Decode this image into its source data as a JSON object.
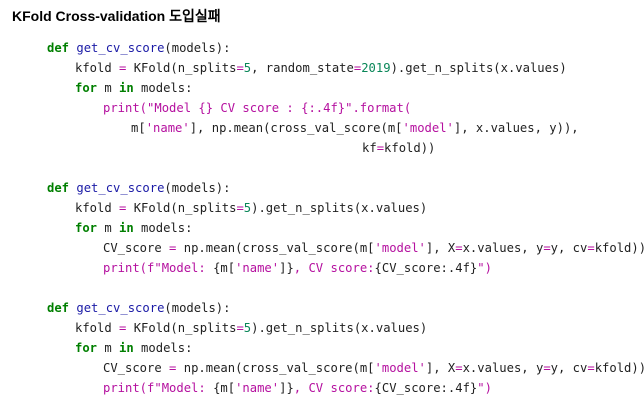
{
  "heading": "KFold Cross-validation 도입실패",
  "colors": {
    "keyword": "#007f00",
    "function_name": "#1a1aa6",
    "string": "#b5109f",
    "number": "#098658",
    "operator": "#b5109f",
    "plain": "#1f1f1f",
    "background": "#ffffff"
  },
  "code_blocks": [
    {
      "lines": [
        {
          "indent": 0,
          "tokens": [
            {
              "t": "kw",
              "v": "def"
            },
            {
              "t": "plain",
              "v": " "
            },
            {
              "t": "fn",
              "v": "get_cv_score"
            },
            {
              "t": "plain",
              "v": "(models):"
            }
          ]
        },
        {
          "indent": 1,
          "tokens": [
            {
              "t": "plain",
              "v": "kfold "
            },
            {
              "t": "op",
              "v": "="
            },
            {
              "t": "plain",
              "v": " KFold(n_splits"
            },
            {
              "t": "op",
              "v": "="
            },
            {
              "t": "num",
              "v": "5"
            },
            {
              "t": "plain",
              "v": ", random_state"
            },
            {
              "t": "op",
              "v": "="
            },
            {
              "t": "num",
              "v": "2019"
            },
            {
              "t": "plain",
              "v": ").get_n_splits(x.values)"
            }
          ]
        },
        {
          "indent": 1,
          "tokens": [
            {
              "t": "kw",
              "v": "for"
            },
            {
              "t": "plain",
              "v": " m "
            },
            {
              "t": "kw",
              "v": "in"
            },
            {
              "t": "plain",
              "v": " models:"
            }
          ]
        },
        {
          "indent": 2,
          "tokens": [
            {
              "t": "str",
              "v": "print(\"Model {} CV score : {:.4f}\".format("
            }
          ]
        },
        {
          "indent": 3,
          "tokens": [
            {
              "t": "plain",
              "v": "m["
            },
            {
              "t": "str",
              "v": "'name'"
            },
            {
              "t": "plain",
              "v": "], np.mean(cross_val_score(m["
            },
            {
              "t": "str",
              "v": "'model'"
            },
            {
              "t": "plain",
              "v": "], x.values, y)),"
            }
          ]
        },
        {
          "indent": 4,
          "tokens": [
            {
              "t": "plain",
              "v": "kf"
            },
            {
              "t": "op",
              "v": "="
            },
            {
              "t": "plain",
              "v": "kfold))"
            }
          ]
        }
      ]
    },
    {
      "lines": [
        {
          "indent": 0,
          "tokens": [
            {
              "t": "kw",
              "v": "def"
            },
            {
              "t": "plain",
              "v": " "
            },
            {
              "t": "fn",
              "v": "get_cv_score"
            },
            {
              "t": "plain",
              "v": "(models):"
            }
          ]
        },
        {
          "indent": 1,
          "tokens": [
            {
              "t": "plain",
              "v": "kfold "
            },
            {
              "t": "op",
              "v": "="
            },
            {
              "t": "plain",
              "v": " KFold(n_splits"
            },
            {
              "t": "op",
              "v": "="
            },
            {
              "t": "num",
              "v": "5"
            },
            {
              "t": "plain",
              "v": ").get_n_splits(x.values)"
            }
          ]
        },
        {
          "indent": 1,
          "tokens": [
            {
              "t": "kw",
              "v": "for"
            },
            {
              "t": "plain",
              "v": " m "
            },
            {
              "t": "kw",
              "v": "in"
            },
            {
              "t": "plain",
              "v": " models:"
            }
          ]
        },
        {
          "indent": 2,
          "tokens": [
            {
              "t": "plain",
              "v": "CV_score "
            },
            {
              "t": "op",
              "v": "="
            },
            {
              "t": "plain",
              "v": " np.mean(cross_val_score(m["
            },
            {
              "t": "str",
              "v": "'model'"
            },
            {
              "t": "plain",
              "v": "], X"
            },
            {
              "t": "op",
              "v": "="
            },
            {
              "t": "plain",
              "v": "x.values, y"
            },
            {
              "t": "op",
              "v": "="
            },
            {
              "t": "plain",
              "v": "y, cv"
            },
            {
              "t": "op",
              "v": "="
            },
            {
              "t": "plain",
              "v": "kfold))"
            }
          ]
        },
        {
          "indent": 2,
          "tokens": [
            {
              "t": "str",
              "v": "print(f\"Model: "
            },
            {
              "t": "plain",
              "v": "{m["
            },
            {
              "t": "str",
              "v": "'name'"
            },
            {
              "t": "plain",
              "v": "]}"
            },
            {
              "t": "str",
              "v": ", CV score:"
            },
            {
              "t": "plain",
              "v": "{CV_score:.4f}"
            },
            {
              "t": "str",
              "v": "\")"
            }
          ]
        }
      ]
    },
    {
      "lines": [
        {
          "indent": 0,
          "tokens": [
            {
              "t": "kw",
              "v": "def"
            },
            {
              "t": "plain",
              "v": " "
            },
            {
              "t": "fn",
              "v": "get_cv_score"
            },
            {
              "t": "plain",
              "v": "(models):"
            }
          ]
        },
        {
          "indent": 1,
          "tokens": [
            {
              "t": "plain",
              "v": "kfold "
            },
            {
              "t": "op",
              "v": "="
            },
            {
              "t": "plain",
              "v": " KFold(n_splits"
            },
            {
              "t": "op",
              "v": "="
            },
            {
              "t": "num",
              "v": "5"
            },
            {
              "t": "plain",
              "v": ").get_n_splits(x.values)"
            }
          ]
        },
        {
          "indent": 1,
          "tokens": [
            {
              "t": "kw",
              "v": "for"
            },
            {
              "t": "plain",
              "v": " m "
            },
            {
              "t": "kw",
              "v": "in"
            },
            {
              "t": "plain",
              "v": " models:"
            }
          ]
        },
        {
          "indent": 2,
          "tokens": [
            {
              "t": "plain",
              "v": "CV_score "
            },
            {
              "t": "op",
              "v": "="
            },
            {
              "t": "plain",
              "v": " np.mean(cross_val_score(m["
            },
            {
              "t": "str",
              "v": "'model'"
            },
            {
              "t": "plain",
              "v": "], X"
            },
            {
              "t": "op",
              "v": "="
            },
            {
              "t": "plain",
              "v": "x.values, y"
            },
            {
              "t": "op",
              "v": "="
            },
            {
              "t": "plain",
              "v": "y, cv"
            },
            {
              "t": "op",
              "v": "="
            },
            {
              "t": "plain",
              "v": "kfold))"
            }
          ]
        },
        {
          "indent": 2,
          "tokens": [
            {
              "t": "str",
              "v": "print(f\"Model: "
            },
            {
              "t": "plain",
              "v": "{m["
            },
            {
              "t": "str",
              "v": "'name'"
            },
            {
              "t": "plain",
              "v": "]}"
            },
            {
              "t": "str",
              "v": ", CV score:"
            },
            {
              "t": "plain",
              "v": "{CV_score:.4f}"
            },
            {
              "t": "str",
              "v": "\")"
            }
          ]
        }
      ]
    }
  ]
}
